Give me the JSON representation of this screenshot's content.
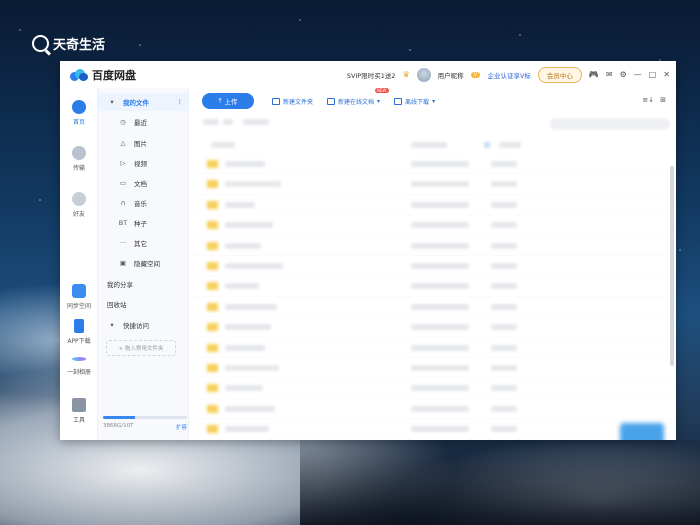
{
  "watermark": {
    "brand": "天奇生活"
  },
  "app": {
    "name": "百度网盘"
  },
  "header": {
    "svip_text": "SVIP限时买1送2",
    "username": "用户昵称",
    "enterprise_label": "企业认证享V标",
    "vip_center": "会员中心"
  },
  "leftbar": {
    "home": "首页",
    "transfer": "传输",
    "friends": "好友",
    "sync_space": "同步空间",
    "app_download": "APP下载",
    "one_scan": "一刻相册",
    "tools": "工具"
  },
  "sidebar": {
    "my_files": "我的文件",
    "items": [
      {
        "label": "最近",
        "icon": "clock-icon"
      },
      {
        "label": "图片",
        "icon": "image-icon"
      },
      {
        "label": "视频",
        "icon": "play-icon"
      },
      {
        "label": "文档",
        "icon": "document-icon"
      },
      {
        "label": "音乐",
        "icon": "headphones-icon"
      },
      {
        "label": "种子",
        "icon": "bt-icon"
      },
      {
        "label": "其它",
        "icon": "more-icon"
      },
      {
        "label": "隐藏空间",
        "icon": "hidden-space-icon"
      }
    ],
    "my_share": "我的分享",
    "recycle": "回收站",
    "quick_access": "快捷访问",
    "quick_placeholder": "+ 拖入常用文件夹",
    "storage_text": "3866G/10T",
    "storage_used_fraction": 0.38,
    "expand": "扩容"
  },
  "toolbar": {
    "upload": "上传",
    "new_folder": "新建文件夹",
    "new_online_doc": "新建在线文档",
    "new_badge": "NEW",
    "offline_download": "离线下载"
  },
  "colors": {
    "accent": "#2b7de9",
    "folder": "#f6cf56"
  }
}
